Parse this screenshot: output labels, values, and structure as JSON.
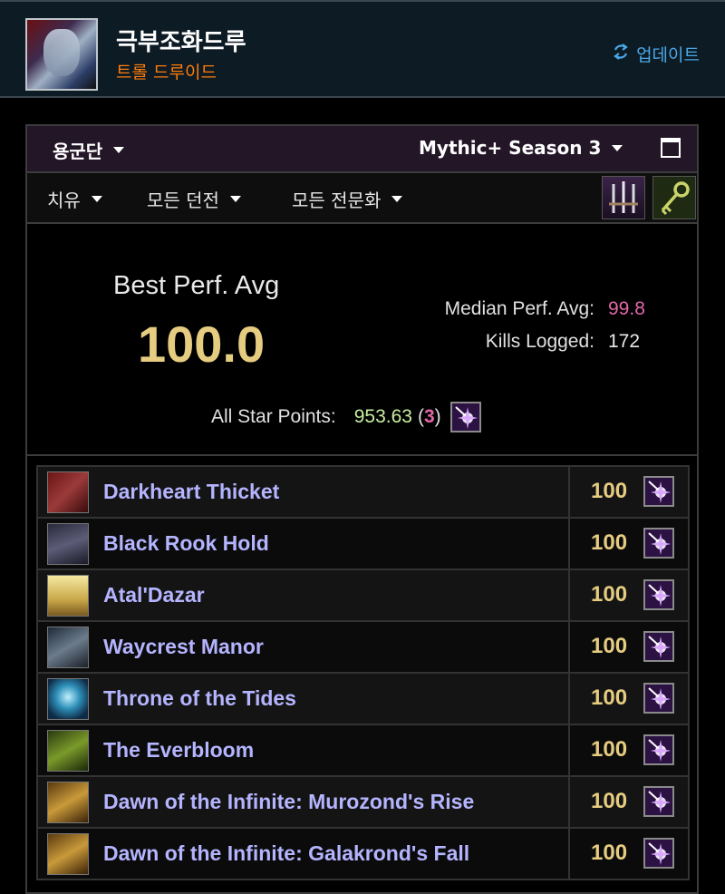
{
  "header": {
    "character_name": "극부조화드루",
    "character_subtitle": "트롤 드루이드",
    "update_label": "업데이트",
    "class_color": "#ff7c0a",
    "update_color": "#4aa8e8"
  },
  "filters": {
    "raid_zone": "용군단",
    "season": "Mythic+ Season 3",
    "role": "치유",
    "dungeon": "모든 던전",
    "spec": "모든 전문화"
  },
  "summary": {
    "best_label": "Best Perf. Avg",
    "best_value": "100.0",
    "median_label": "Median Perf. Avg:",
    "median_value": "99.8",
    "kills_label": "Kills Logged:",
    "kills_value": "172",
    "allstar_label": "All Star Points:",
    "allstar_value": "953.63",
    "allstar_open": "(",
    "allstar_rank": "3",
    "allstar_close": ")",
    "best_color": "#e5cc80",
    "median_color": "#e268a8"
  },
  "dungeons": [
    {
      "name": "Darkheart Thicket",
      "score": "100",
      "icon": "darkheart-thicket-icon"
    },
    {
      "name": "Black Rook Hold",
      "score": "100",
      "icon": "black-rook-hold-icon"
    },
    {
      "name": "Atal'Dazar",
      "score": "100",
      "icon": "ataldazar-icon"
    },
    {
      "name": "Waycrest Manor",
      "score": "100",
      "icon": "waycrest-manor-icon"
    },
    {
      "name": "Throne of the Tides",
      "score": "100",
      "icon": "throne-of-the-tides-icon"
    },
    {
      "name": "The Everbloom",
      "score": "100",
      "icon": "everbloom-icon"
    },
    {
      "name": "Dawn of the Infinite: Murozond's Rise",
      "score": "100",
      "icon": "murozonds-rise-icon"
    },
    {
      "name": "Dawn of the Infinite: Galakrond's Fall",
      "score": "100",
      "icon": "galakronds-fall-icon"
    }
  ]
}
